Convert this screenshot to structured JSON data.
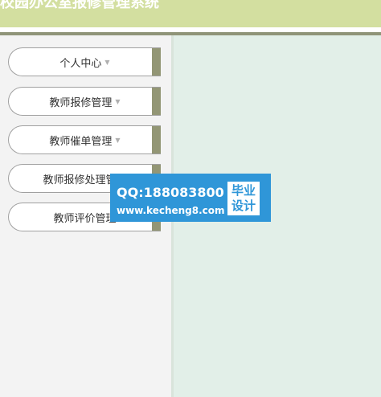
{
  "header": {
    "title": "校园办公室报修管理系统"
  },
  "sidebar": {
    "items": [
      {
        "label": "个人中心",
        "caret": "▼"
      },
      {
        "label": "教师报修管理",
        "caret": "▼"
      },
      {
        "label": "教师催单管理",
        "caret": "▼"
      },
      {
        "label": "教师报修处理管理"
      },
      {
        "label": "教师评价管理"
      }
    ]
  },
  "watermark": {
    "qq": "QQ:188083800",
    "url": "www.kecheng8.com",
    "badge_line1": "毕业",
    "badge_line2": "设计"
  },
  "colors": {
    "header_bg": "#d3dfa0",
    "accent_bar": "#939675",
    "content_bg": "#e2efe8",
    "watermark_bg": "#2f96d8"
  }
}
